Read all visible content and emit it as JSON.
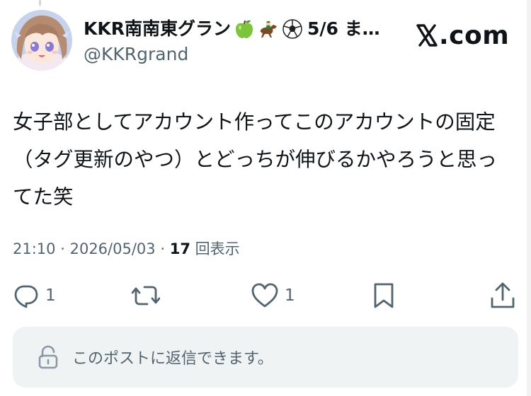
{
  "author": {
    "display_name": "KKR南南東グラン",
    "display_suffix": "5/6 ま…",
    "handle": "@KKRgrand",
    "avatar_icon": "anime-girl-avatar",
    "name_emojis": [
      "green-apple-icon",
      "horse-racing-icon",
      "soccer-ball-icon"
    ]
  },
  "brand": {
    "label": ".com",
    "logo_icon": "x-logo-icon"
  },
  "post": {
    "text": "女子部としてアカウント作ってこのアカウントの固定（タグ更新のやつ）とどっちが伸びるかやろうと思ってた笑",
    "time": "21:10",
    "date": "2026/05/03",
    "separator": "·",
    "views_count": "17",
    "views_label": "回表示"
  },
  "actions": {
    "reply_count": "1",
    "repost_count": "",
    "like_count": "1",
    "bookmark_count": "",
    "share_count": ""
  },
  "reply_box": {
    "text": "このポストに返信できます。",
    "icon": "lock-icon"
  },
  "colors": {
    "text_primary": "#0f1419",
    "text_secondary": "#536471",
    "reply_bg": "#eff3f4"
  }
}
